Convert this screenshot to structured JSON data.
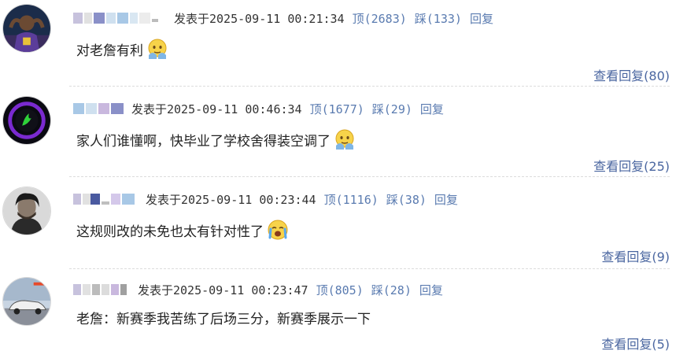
{
  "comments": [
    {
      "posted_label": "发表于2025-09-11 00:21:34",
      "up_label": "顶(2683)",
      "down_label": "踩(133)",
      "reply_label": "回复",
      "content": "对老詹有利",
      "emoji": "shy-face-emoji",
      "view_replies_label": "查看回复(80)",
      "avatar": "basketball-player-avatar"
    },
    {
      "posted_label": "发表于2025-09-11 00:46:34",
      "up_label": "顶(1677)",
      "down_label": "踩(29)",
      "reply_label": "回复",
      "content": "家人们谁懂啊，快毕业了学校舍得装空调了",
      "emoji": "shy-face-emoji",
      "view_replies_label": "查看回复(25)",
      "avatar": "razer-logo-avatar"
    },
    {
      "posted_label": "发表于2025-09-11 00:23:44",
      "up_label": "顶(1116)",
      "down_label": "踩(38)",
      "reply_label": "回复",
      "content": "这规则改的未免也太有针对性了",
      "emoji": "crying-face-emoji",
      "view_replies_label": "查看回复(9)",
      "avatar": "portrait-avatar"
    },
    {
      "posted_label": "发表于2025-09-11 00:23:47",
      "up_label": "顶(805)",
      "down_label": "踩(28)",
      "reply_label": "回复",
      "content": "老詹：新赛季我苦练了后场三分，新赛季展示一下",
      "emoji": "",
      "view_replies_label": "查看回复(5)",
      "avatar": "car-avatar"
    }
  ],
  "colors": {
    "link": "#5a7bb0",
    "view_replies": "#4a66a0",
    "text": "#222222",
    "divider": "#dcdcdc"
  }
}
